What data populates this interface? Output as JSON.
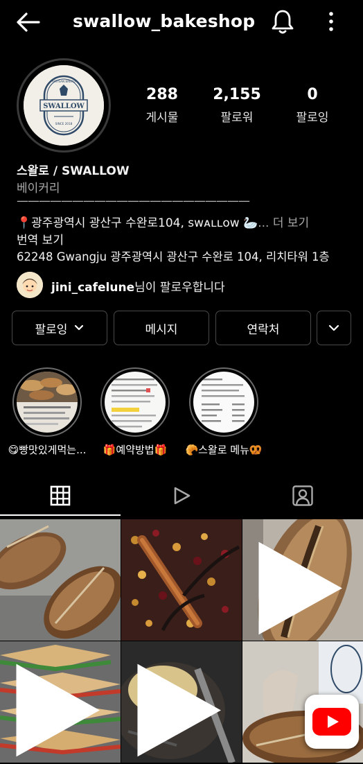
{
  "header": {
    "username": "swallow_bakeshop",
    "back_icon": "arrow-left-icon",
    "bell_icon": "bell-icon",
    "more_icon": "more-vertical-icon"
  },
  "profile": {
    "avatar_logo_text": "SWALLOW",
    "avatar_arc_top": "ARTISAN BREAD",
    "avatar_arc_bottom": "SINCE 2018",
    "stats": [
      {
        "value": "288",
        "label": "게시물"
      },
      {
        "value": "2,155",
        "label": "팔로워"
      },
      {
        "value": "0",
        "label": "팔로잉"
      }
    ],
    "name": "스왈로 / SWALLOW",
    "category": "베이커리",
    "divider": "—————————————————————",
    "address_line": "📍광주광역시 광산구 수완로104, sᴡᴀʟʟᴏᴡ 🦢",
    "address_ellipsis": "...",
    "more_label": "더 보기",
    "translate_label": "번역 보기",
    "location": "62248 Gwangju 광주광역시 광산구 수완로 104, 리치타워 1층"
  },
  "followed_by": {
    "username": "jini_cafelune",
    "suffix": "님이 팔로우합니다"
  },
  "actions": {
    "following_label": "팔로잉",
    "message_label": "메시지",
    "contact_label": "연락처"
  },
  "highlights": [
    {
      "label": "😋빵맛있게먹는..."
    },
    {
      "label": "🎁예약방법🎁"
    },
    {
      "label": "🥐스왈로 메뉴🥨"
    }
  ],
  "tabs": [
    {
      "name": "grid",
      "icon": "grid-icon",
      "active": true
    },
    {
      "name": "reels",
      "icon": "reels-play-icon",
      "active": false
    },
    {
      "name": "tagged",
      "icon": "tagged-person-icon",
      "active": false
    }
  ],
  "colors": {
    "background": "#000000",
    "text": "#f5f5f5",
    "muted": "#a8a8a8",
    "border": "#4a4a4a",
    "youtube_red": "#ff0000"
  }
}
